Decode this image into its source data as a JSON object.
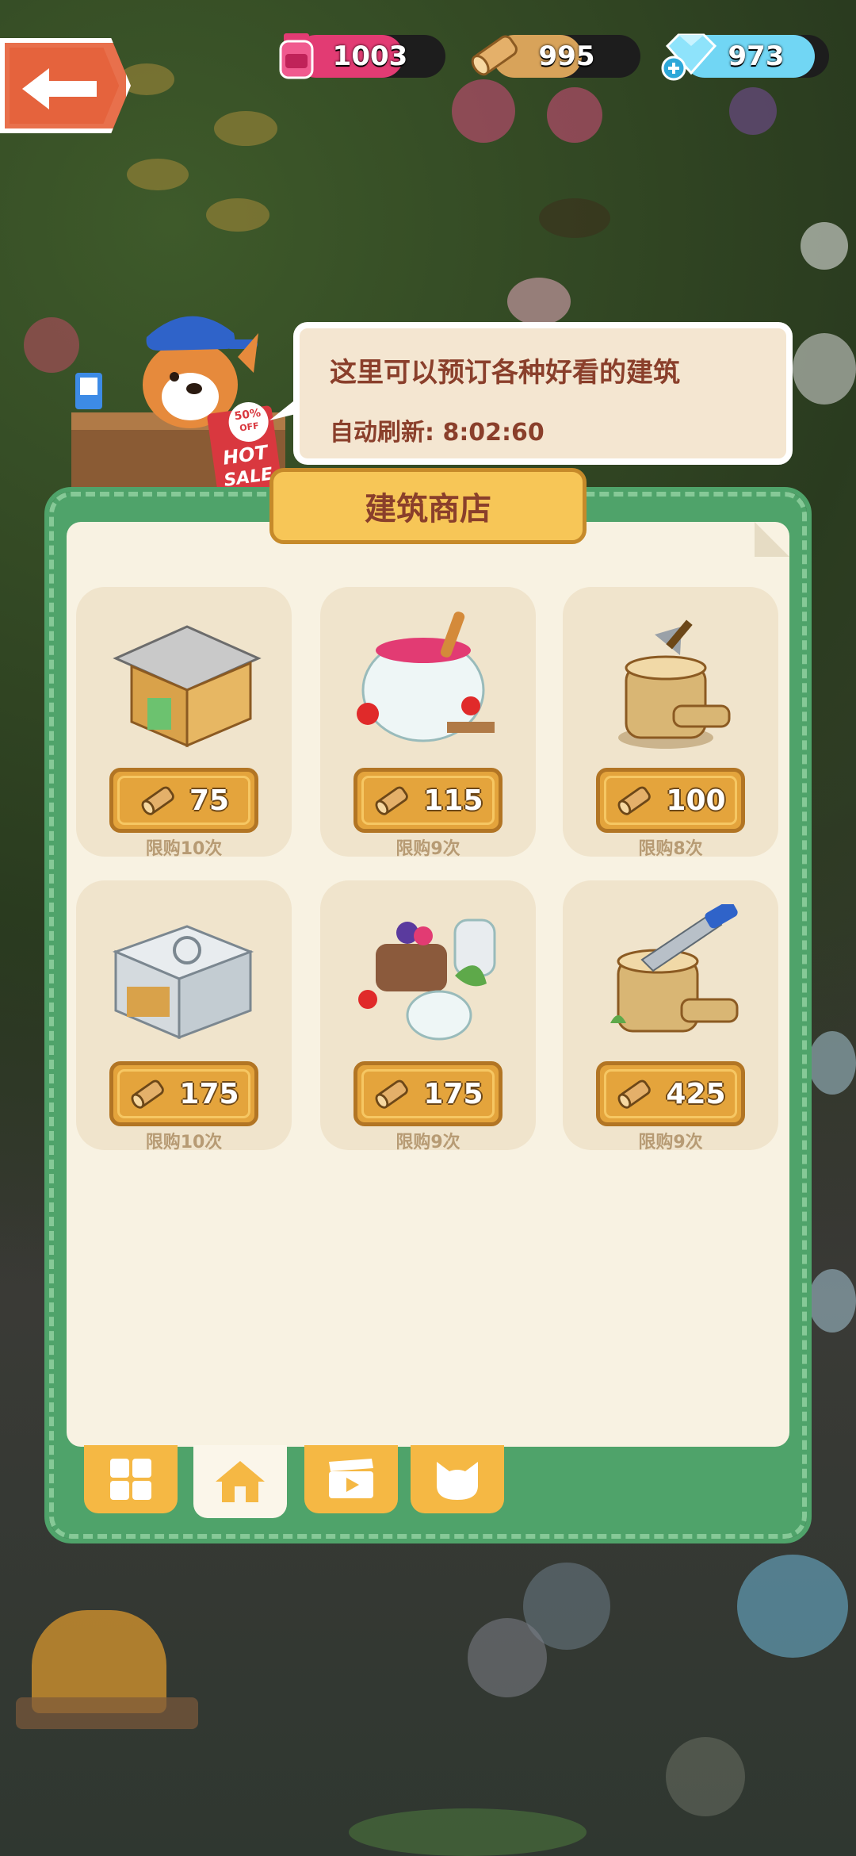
{
  "resources": {
    "jam": {
      "value": "1003",
      "icon": "jam-jar-icon",
      "color": "#e23b73",
      "level": 0.72
    },
    "wood": {
      "value": "995",
      "icon": "wood-log-icon",
      "color": "#d8a35a",
      "level": 0.6
    },
    "gems": {
      "value": "973",
      "icon": "blue-gem-icon",
      "color": "#71d6f4",
      "level": 0.9
    }
  },
  "bubble": {
    "line1": "这里可以预订各种好看的建筑",
    "line2": "自动刷新:  8:02:60"
  },
  "sale_sign": {
    "line1": "50%",
    "line2": "OFF",
    "line3": "HOT",
    "line4": "SALE"
  },
  "shop": {
    "title": "建筑商店",
    "items": [
      {
        "icon": "wooden-house-icon",
        "price": "75",
        "limit": "限购10次"
      },
      {
        "icon": "jam-pot-icon",
        "price": "115",
        "limit": "限购9次"
      },
      {
        "icon": "tree-stump-axe-icon",
        "price": "100",
        "limit": "限购8次"
      },
      {
        "icon": "metal-oven-icon",
        "price": "175",
        "limit": "限购10次"
      },
      {
        "icon": "berry-jars-icon",
        "price": "175",
        "limit": "限购9次"
      },
      {
        "icon": "stump-saw-icon",
        "price": "425",
        "limit": "限购9次"
      }
    ],
    "tabs": [
      {
        "icon": "grid-icon",
        "active": false
      },
      {
        "icon": "house-icon",
        "active": true
      },
      {
        "icon": "video-icon",
        "active": false
      },
      {
        "icon": "cat-face-icon",
        "active": false
      }
    ]
  },
  "colors": {
    "accent_green": "#4fa36a",
    "price_gold": "#e4a43c",
    "text_brown": "#8a3f2b"
  }
}
